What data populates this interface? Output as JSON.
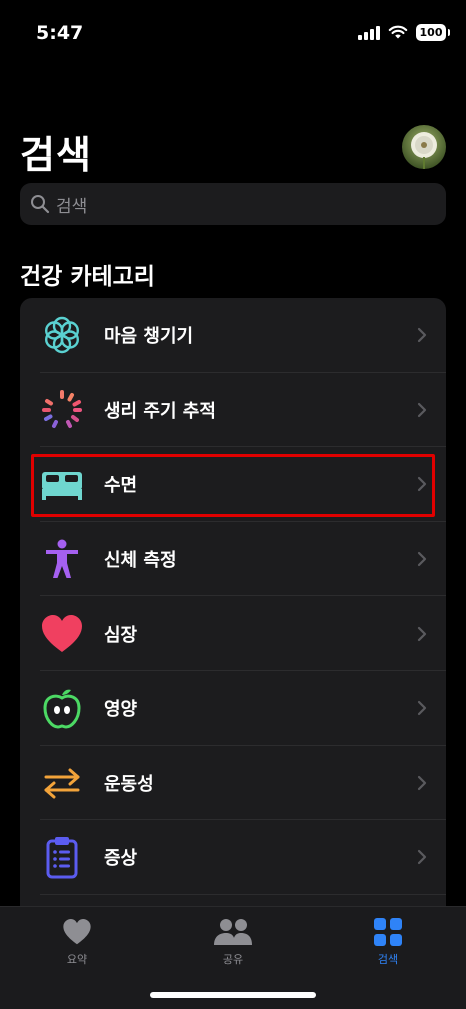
{
  "status": {
    "time": "5:47",
    "battery": "100"
  },
  "header": {
    "title": "검색",
    "avatar_icon": "dandelion-avatar"
  },
  "search": {
    "placeholder": "검색"
  },
  "section": {
    "title": "건강 카테고리"
  },
  "categories": [
    {
      "label": "마음 챙기기",
      "icon": "mindfulness-icon",
      "color": "#5ad1d1"
    },
    {
      "label": "생리 주기 추적",
      "icon": "cycle-tracking-icon",
      "color": "#f06a8a"
    },
    {
      "label": "수면",
      "icon": "sleep-bed-icon",
      "color": "#6fd6cf"
    },
    {
      "label": "신체 측정",
      "icon": "body-measurements-icon",
      "color": "#a560f0"
    },
    {
      "label": "심장",
      "icon": "heart-icon",
      "color": "#f04060"
    },
    {
      "label": "영양",
      "icon": "nutrition-apple-icon",
      "color": "#4cd964"
    },
    {
      "label": "운동성",
      "icon": "mobility-arrows-icon",
      "color": "#f2a33a"
    },
    {
      "label": "증상",
      "icon": "symptoms-clipboard-icon",
      "color": "#5b5cf0"
    }
  ],
  "tabs": [
    {
      "label": "요약",
      "icon": "heart-icon",
      "active": false
    },
    {
      "label": "공유",
      "icon": "people-icon",
      "active": false
    },
    {
      "label": "검색",
      "icon": "grid-icon",
      "active": true
    }
  ],
  "colors": {
    "accent": "#2f83f7",
    "highlight_border": "#e00000",
    "background": "#000000",
    "card": "#1c1c1e"
  }
}
